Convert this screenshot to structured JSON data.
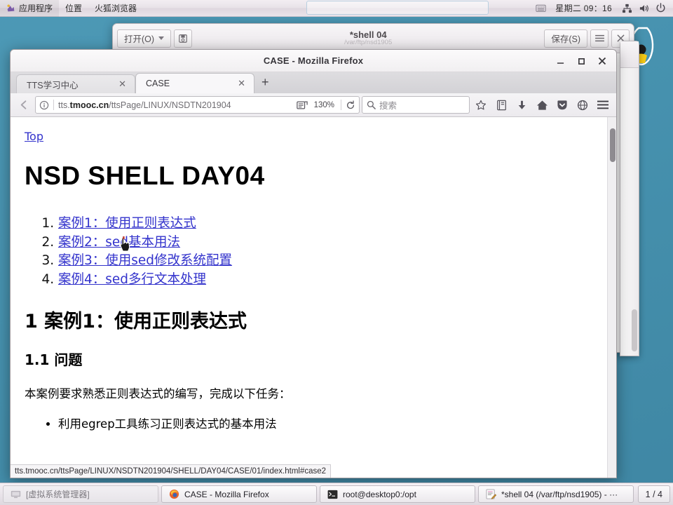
{
  "panel": {
    "menus": [
      "应用程序",
      "位置",
      "火狐浏览器"
    ],
    "clock": "星期二 09：16",
    "icons": [
      "keyboard-indicator-icon",
      "network-icon",
      "volume-icon",
      "power-icon"
    ]
  },
  "gedit": {
    "open_button": "打开(O)",
    "save_button": "保存(S)",
    "title": "*shell 04",
    "subtitle": "/var/ftp/nsd1905",
    "menu_icon": "hamburger-icon",
    "close_icon": "close-icon",
    "save_as_icon": "save-as-icon"
  },
  "firefox": {
    "window_title": "CASE - Mozilla Firefox",
    "window_controls": {
      "minimize": "−",
      "maximize": "❐",
      "close": "✕"
    },
    "tabs": [
      {
        "label": "TTS学习中心",
        "active": false,
        "close": "✕"
      },
      {
        "label": "CASE",
        "active": true,
        "close": "✕"
      }
    ],
    "new_tab_label": "+",
    "nav": {
      "back_icon": "back-arrow-icon",
      "identity_icon": "info-circle-icon",
      "url_prefix": "tts.",
      "url_domain": "tmooc.cn",
      "url_path": "/ttsPage/LINUX/NSDTN201904",
      "reader_icon": "reader-view-icon",
      "zoom_level": "130%",
      "reload_icon": "reload-icon",
      "search_placeholder": "搜索",
      "search_icon": "search-icon",
      "bookmark_icon": "star-icon",
      "library_icon": "library-icon",
      "downloads_icon": "download-arrow-icon",
      "home_icon": "home-icon",
      "pocket_icon": "pocket-icon",
      "account_icon": "globe-icon",
      "menu_icon": "hamburger-icon"
    },
    "status_url": "tts.tmooc.cn/ttsPage/LINUX/NSDTN201904/SHELL/DAY04/CASE/01/index.html#case2"
  },
  "page": {
    "top_link": "Top",
    "h1": "NSD SHELL DAY04",
    "toc": [
      "案例1：使用正则表达式",
      "案例2：sed基本用法",
      "案例3：使用sed修改系统配置",
      "案例4：sed多行文本处理"
    ],
    "h2": "1 案例1：使用正则表达式",
    "h3": "1.1 问题",
    "paragraph": "本案例要求熟悉正则表达式的编写，完成以下任务：",
    "bullets": [
      "利用egrep工具练习正则表达式的基本用法"
    ]
  },
  "taskbar": {
    "items": [
      {
        "label": "[虚拟系统管理器]",
        "icon": "vm-manager-icon",
        "active": false
      },
      {
        "label": "CASE - Mozilla Firefox",
        "icon": "firefox-icon",
        "active": true
      },
      {
        "label": "root@desktop0:/opt",
        "icon": "terminal-icon",
        "active": false
      },
      {
        "label": "*shell 04 (/var/ftp/nsd1905) - ···",
        "icon": "gedit-icon",
        "active": false
      }
    ],
    "workspace": "1 / 4"
  },
  "colors": {
    "desktop": "#4a95b3",
    "link": "#3333cc",
    "panel": "#e9e4ea"
  }
}
